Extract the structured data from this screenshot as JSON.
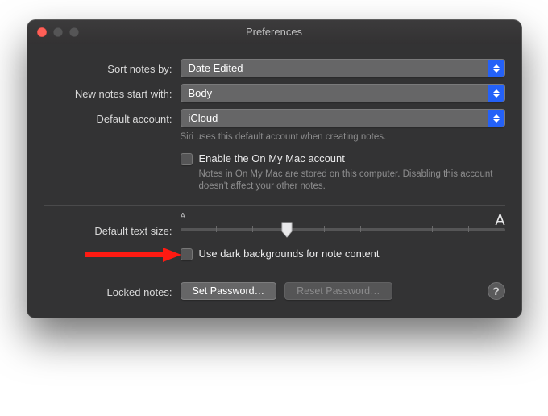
{
  "window": {
    "title": "Preferences"
  },
  "rows": {
    "sort_label": "Sort notes by:",
    "sort_value": "Date Edited",
    "start_label": "New notes start with:",
    "start_value": "Body",
    "account_label": "Default account:",
    "account_value": "iCloud",
    "account_hint": "Siri uses this default account when creating notes.",
    "onmymac_label": "Enable the On My Mac account",
    "onmymac_hint": "Notes in On My Mac are stored on this computer. Disabling this account doesn't affect your other notes.",
    "textsize_label": "Default text size:",
    "textsize_min": "A",
    "textsize_max": "A",
    "darkbg_label": "Use dark backgrounds for note content",
    "locked_label": "Locked notes:",
    "set_password": "Set Password…",
    "reset_password": "Reset Password…",
    "help": "?"
  }
}
